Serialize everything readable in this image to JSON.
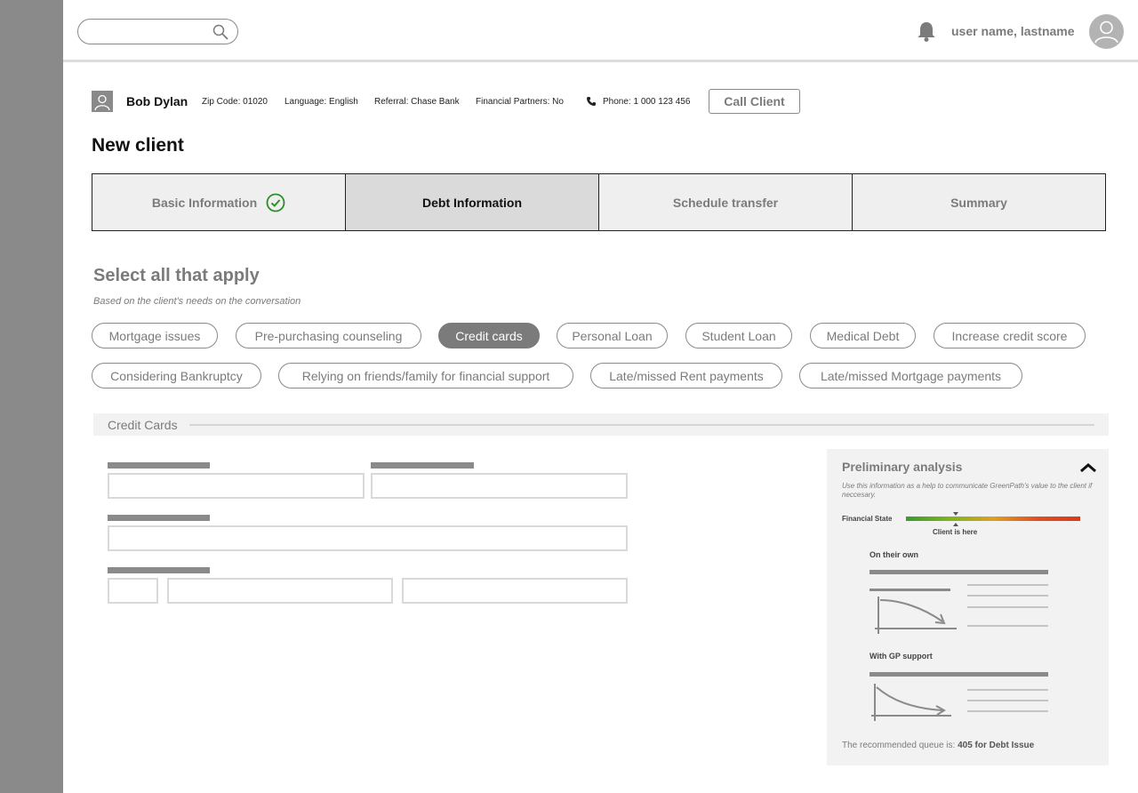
{
  "header": {
    "search": {
      "placeholder": "",
      "icon": "search-icon"
    },
    "notification_icon": "bell-icon",
    "user_name": "user name, lastname",
    "avatar_icon": "user-avatar-icon"
  },
  "client": {
    "name": "Bob Dylan",
    "zip": "Zip Code: 01020",
    "language": "Language: English",
    "referral": "Referral: Chase Bank",
    "partners": "Financial Partners: No",
    "phone": "Phone: 1 000 123 456",
    "call_label": "Call Client"
  },
  "page": {
    "title": "New client"
  },
  "steps": [
    {
      "label": "Basic Information",
      "state": "complete"
    },
    {
      "label": "Debt Information",
      "state": "active"
    },
    {
      "label": "Schedule transfer",
      "state": "pending"
    },
    {
      "label": "Summary",
      "state": "pending"
    }
  ],
  "select": {
    "title": "Select all that apply",
    "subtitle": "Based on the client's needs on the conversation"
  },
  "options": [
    {
      "label": "Mortgage issues",
      "selected": false
    },
    {
      "label": "Pre-purchasing counseling",
      "selected": false
    },
    {
      "label": "Credit cards",
      "selected": true
    },
    {
      "label": "Personal Loan",
      "selected": false
    },
    {
      "label": "Student Loan",
      "selected": false
    },
    {
      "label": "Medical Debt",
      "selected": false
    },
    {
      "label": "Increase credit score",
      "selected": false
    },
    {
      "label": "Considering Bankruptcy",
      "selected": false
    },
    {
      "label": "Relying on friends/family for financial support",
      "selected": false
    },
    {
      "label": "Late/missed Rent payments",
      "selected": false
    },
    {
      "label": "Late/missed Mortgage payments",
      "selected": false
    }
  ],
  "section": {
    "label": "Credit Cards"
  },
  "analysis": {
    "title": "Preliminary analysis",
    "description": "Use this information as a help to communicate GreenPath's value to the client if neccesary.",
    "financial_state_label": "Financial State",
    "client_here": "Client is here",
    "on_their_own": "On their own",
    "with_gp": "With GP support",
    "queue_prefix": "The recommended queue is: ",
    "queue_value": "405 for Debt Issue",
    "colors": {
      "good": "#3c9a2c",
      "mid": "#e0a020",
      "bad": "#d93a1c"
    }
  },
  "colors": {
    "accent_gray": "#7b7b7b",
    "check_green": "#2e8b2e"
  }
}
